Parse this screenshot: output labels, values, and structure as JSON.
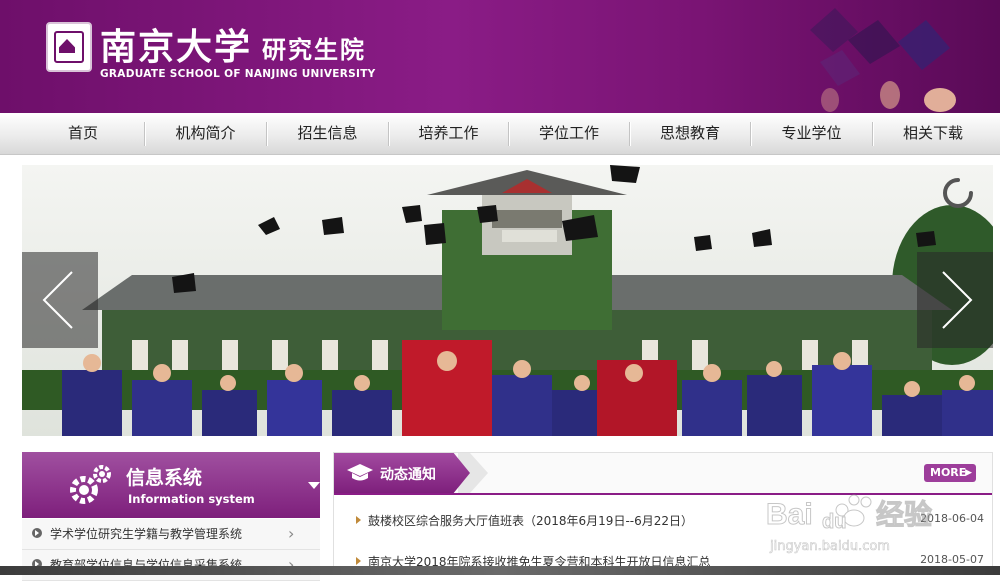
{
  "header": {
    "title_cn_school": "南京大学",
    "title_cn_suffix": "研究生院",
    "title_en": "GRADUATE SCHOOL OF NANJING UNIVERSITY",
    "brand_color": "#7a1474"
  },
  "nav": {
    "items": [
      {
        "label": "首页"
      },
      {
        "label": "机构简介"
      },
      {
        "label": "招生信息"
      },
      {
        "label": "培养工作"
      },
      {
        "label": "学位工作"
      },
      {
        "label": "思想教育"
      },
      {
        "label": "专业学位"
      },
      {
        "label": "相关下载"
      }
    ]
  },
  "banner": {
    "icons": [
      "chevron-left-icon",
      "chevron-right-icon",
      "loading-spinner-icon"
    ]
  },
  "info_system": {
    "title_cn": "信息系统",
    "title_en": "Information system",
    "links": [
      {
        "label": "学术学位研究生学籍与教学管理系统"
      },
      {
        "label": "教育部学位信息与学位信息采集系统"
      }
    ]
  },
  "notices": {
    "tab_label": "动态通知",
    "more_label": "MORE",
    "items": [
      {
        "title": "鼓楼校区综合服务大厅值班表（2018年6月19日--6月22日）",
        "date": "2018-06-04"
      },
      {
        "title": "南京大学2018年院系接收推免生夏令营和本科生开放日信息汇总",
        "date": "2018-05-07"
      }
    ]
  },
  "watermark": {
    "brand": "Bai",
    "brand2": "du",
    "brand_cn": "经验",
    "url": "jingyan.baidu.com"
  }
}
